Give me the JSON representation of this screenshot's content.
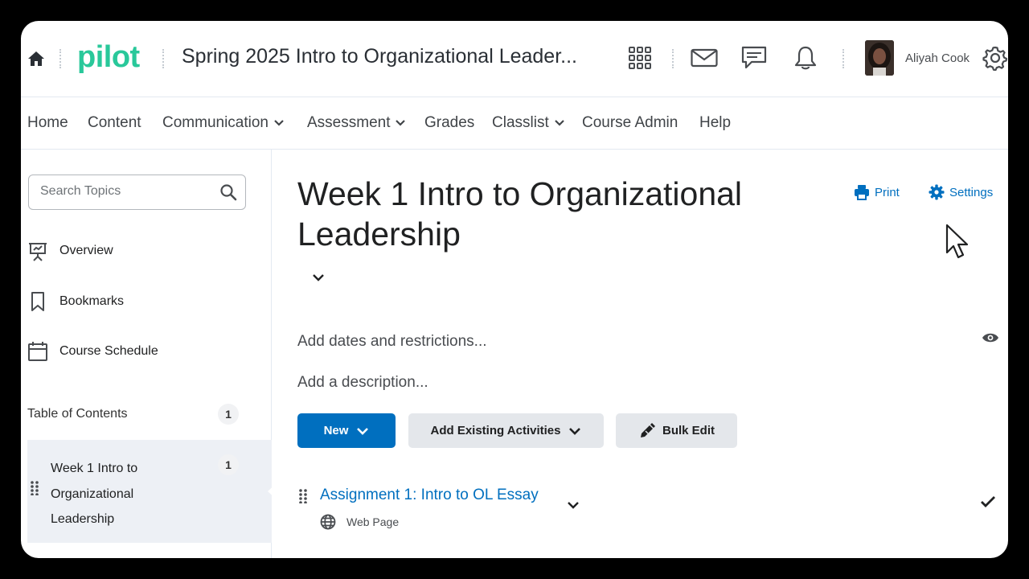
{
  "header": {
    "logo": "pilot",
    "course_title": "Spring 2025 Intro to Organizational Leader...",
    "user_name": "Aliyah Cook",
    "icons": [
      "home-icon",
      "waffle-grid-icon",
      "mail-icon",
      "chat-icon",
      "bell-icon",
      "gear-icon"
    ]
  },
  "nav": {
    "items": [
      {
        "label": "Home",
        "dropdown": false
      },
      {
        "label": "Content",
        "dropdown": false
      },
      {
        "label": "Communication",
        "dropdown": true
      },
      {
        "label": "Assessment",
        "dropdown": true
      },
      {
        "label": "Grades",
        "dropdown": false
      },
      {
        "label": "Classlist",
        "dropdown": true
      },
      {
        "label": "Course Admin",
        "dropdown": false
      },
      {
        "label": "Help",
        "dropdown": false
      }
    ]
  },
  "sidebar": {
    "search_placeholder": "Search Topics",
    "links": [
      {
        "label": "Overview",
        "icon": "presentation-icon"
      },
      {
        "label": "Bookmarks",
        "icon": "bookmark-icon"
      },
      {
        "label": "Course Schedule",
        "icon": "calendar-icon"
      }
    ],
    "toc_label": "Table of Contents",
    "toc_count": "1",
    "modules": [
      {
        "label": "Week 1 Intro to Organizational Leadership",
        "count": "1"
      }
    ]
  },
  "main": {
    "title": "Week 1 Intro to Organizational Leadership",
    "print_label": "Print",
    "settings_label": "Settings",
    "dates_placeholder": "Add dates and restrictions...",
    "description_placeholder": "Add a description...",
    "buttons": {
      "new": "New",
      "add_existing": "Add Existing Activities",
      "bulk_edit": "Bulk Edit"
    },
    "activities": [
      {
        "title": "Assignment 1: Intro to OL Essay",
        "type": "Web Page",
        "completed": true
      }
    ]
  },
  "colors": {
    "brand_green": "#29c89a",
    "primary_blue": "#006fbf",
    "selected_bg": "#edf0f5"
  }
}
